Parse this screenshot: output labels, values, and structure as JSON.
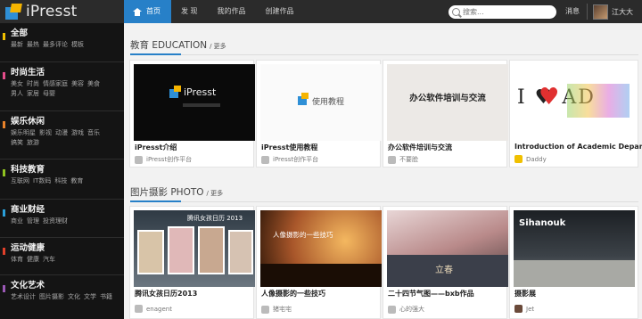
{
  "header": {
    "logo_text": "iPresst",
    "nav": [
      "首页",
      "发 现",
      "我的作品",
      "创建作品"
    ],
    "search_placeholder": "搜索...",
    "messages": "消息",
    "username": "江大大"
  },
  "sidebar": {
    "categories": [
      {
        "title": "全部",
        "color": "#f0c000",
        "links": [
          "最新",
          "最热",
          "最多评论",
          "模板"
        ]
      },
      {
        "title": "时尚生活",
        "color": "#e44d8a",
        "links": [
          "美女",
          "时尚",
          "情感家庭",
          "美容",
          "美食",
          "男人",
          "家居",
          "母婴"
        ]
      },
      {
        "title": "娱乐休闲",
        "color": "#e8822a",
        "links": [
          "娱乐明星",
          "影视",
          "动漫",
          "游戏",
          "音乐",
          "搞笑",
          "旅游"
        ]
      },
      {
        "title": "科技教育",
        "color": "#8fc320",
        "links": [
          "互联网",
          "IT数码",
          "科技",
          "教育"
        ]
      },
      {
        "title": "商业财经",
        "color": "#2a9fd8",
        "links": [
          "商业",
          "管理",
          "投资理财"
        ]
      },
      {
        "title": "运动健康",
        "color": "#e0402a",
        "links": [
          "体育",
          "健康",
          "汽车"
        ]
      },
      {
        "title": "文化艺术",
        "color": "#9b59b6",
        "links": [
          "艺术设计",
          "图片摄影",
          "文化",
          "文学",
          "书籍"
        ]
      }
    ]
  },
  "sections": [
    {
      "title": "教育 EDUCATION",
      "more": "/ 更多",
      "cards": [
        {
          "title": "iPresst介绍",
          "author": "iPresst创作平台",
          "thumb_text": "iPresst"
        },
        {
          "title": "iPresst使用教程",
          "author": "iPresst创作平台",
          "thumb_text": "使用教程"
        },
        {
          "title": "办公软件培训与交流",
          "author": "不要脸",
          "thumb_text": "办公软件培训与交流"
        },
        {
          "title": "Introduction of Academic Depart...",
          "author": "Daddy",
          "thumb_text": "I ♥ AD"
        }
      ]
    },
    {
      "title": "图片摄影 PHOTO",
      "more": "/ 更多",
      "cards": [
        {
          "title": "腾讯女孩日历2013",
          "author": "enagent",
          "thumb_text": "腾讯女孩日历 2013"
        },
        {
          "title": "人像摄影的一些技巧",
          "author": "猪宅宅",
          "thumb_text": "人像摄影的一些技巧"
        },
        {
          "title": "二十四节气图——bxb作品",
          "author": "心的强大",
          "thumb_text": "立春"
        },
        {
          "title": "摄影展",
          "author": "Jet",
          "thumb_text": "Sihanouk"
        }
      ]
    }
  ]
}
